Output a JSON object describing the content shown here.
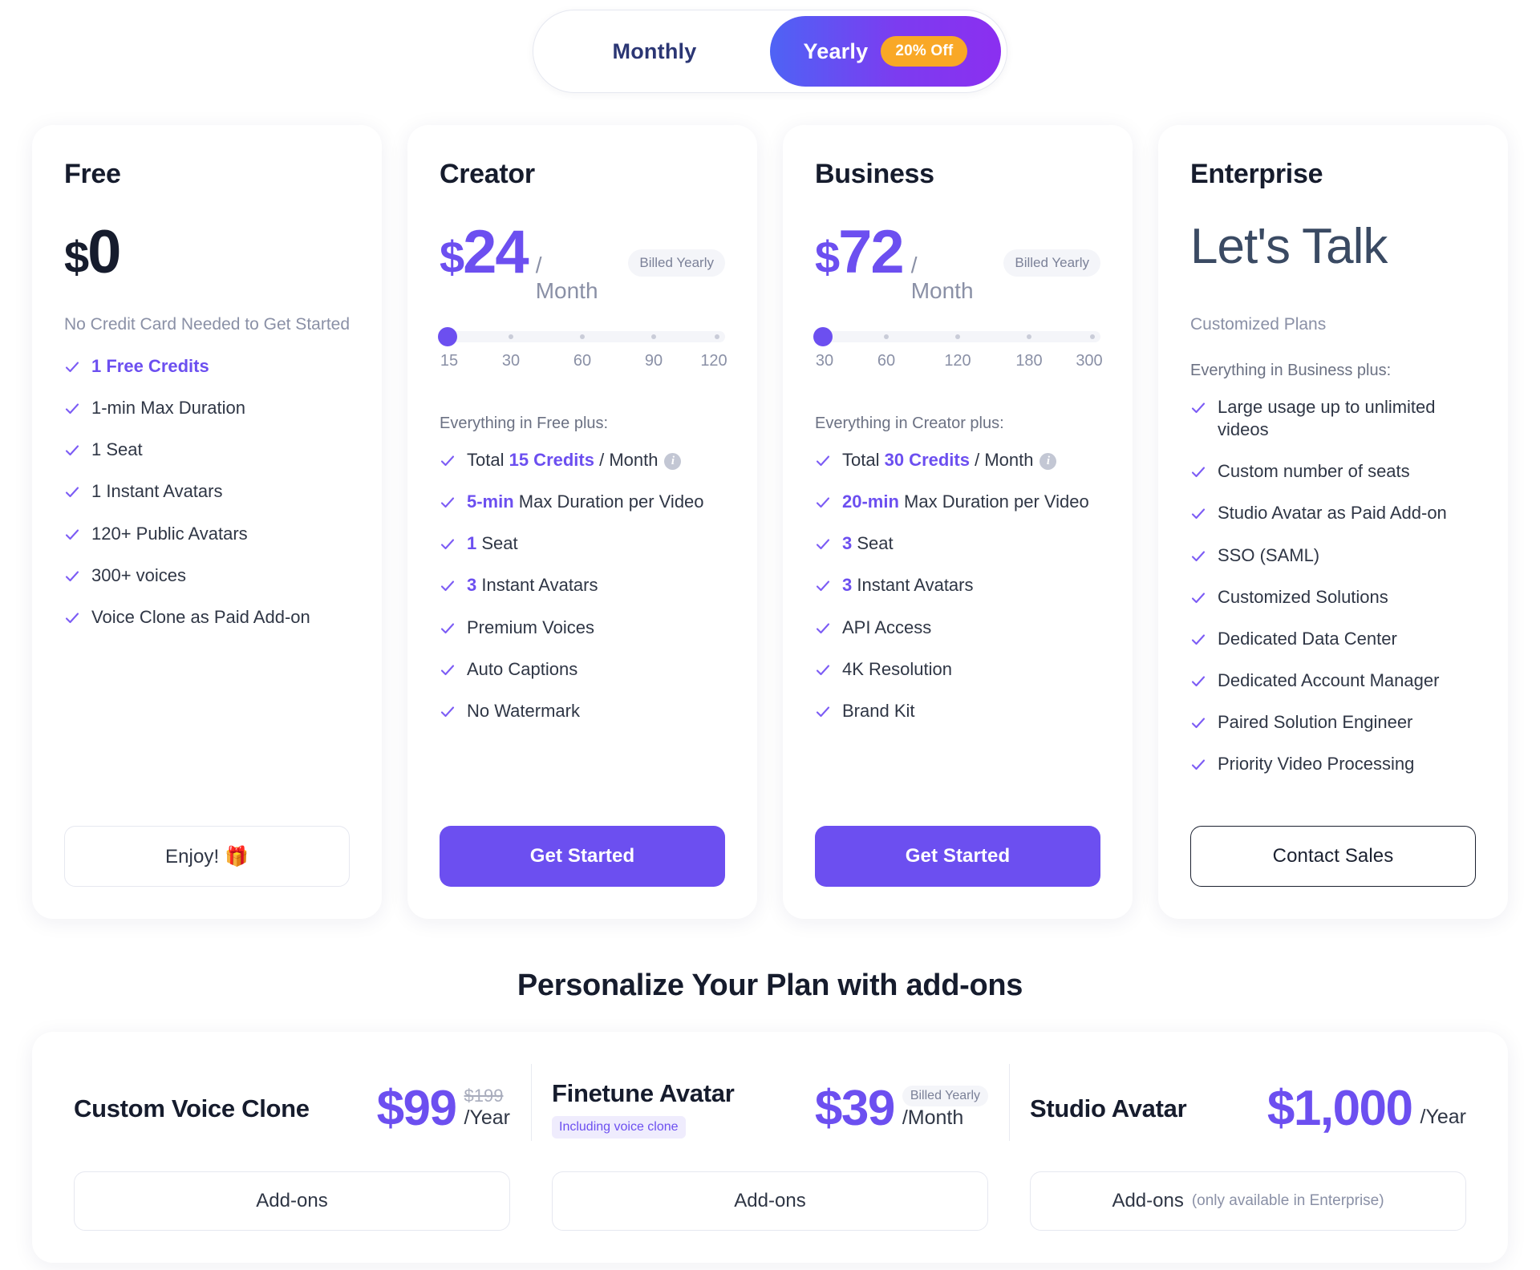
{
  "billing_toggle": {
    "monthly_label": "Monthly",
    "yearly_label": "Yearly",
    "discount_badge": "20% Off",
    "selected": "Yearly"
  },
  "accent_color": "#6c4ff0",
  "plans": [
    {
      "name": "Free",
      "currency": "$",
      "price": "0",
      "period": "",
      "billed": "",
      "subnote": "No Credit Card Needed to Get Started",
      "plus_line": "",
      "slider": null,
      "features": [
        {
          "text": "1 Free Credits",
          "style": "all-highlight"
        },
        {
          "text": "1-min Max Duration",
          "style": "plain"
        },
        {
          "text": "1 Seat",
          "style": "plain"
        },
        {
          "text": "1 Instant Avatars",
          "style": "plain"
        },
        {
          "text": "120+ Public Avatars",
          "style": "plain"
        },
        {
          "text": "300+ voices",
          "style": "plain"
        },
        {
          "text": "Voice Clone as Paid Add-on",
          "style": "plain"
        }
      ],
      "cta_label": "Enjoy! 🎁",
      "cta_style": "light"
    },
    {
      "name": "Creator",
      "currency": "$",
      "price": "24",
      "period": "/ Month",
      "billed": "Billed Yearly",
      "subnote": "",
      "plus_line": "Everything in Free plus:",
      "slider": {
        "ticks": [
          "15",
          "30",
          "60",
          "90",
          "120"
        ],
        "selected_index": 0
      },
      "features": [
        {
          "prefix": "Total ",
          "highlight": "15 Credits",
          "suffix": " / Month",
          "info": true,
          "style": "mixed"
        },
        {
          "highlight": "5-min",
          "suffix": " Max Duration per Video",
          "style": "mixed"
        },
        {
          "highlight": "1",
          "suffix": " Seat",
          "style": "mixed"
        },
        {
          "highlight": "3",
          "suffix": " Instant Avatars",
          "style": "mixed"
        },
        {
          "text": "Premium Voices",
          "style": "plain"
        },
        {
          "text": "Auto Captions",
          "style": "plain"
        },
        {
          "text": "No Watermark",
          "style": "plain"
        }
      ],
      "cta_label": "Get Started",
      "cta_style": "primary"
    },
    {
      "name": "Business",
      "currency": "$",
      "price": "72",
      "period": "/ Month",
      "billed": "Billed Yearly",
      "subnote": "",
      "plus_line": "Everything in Creator plus:",
      "slider": {
        "ticks": [
          "30",
          "60",
          "120",
          "180",
          "300"
        ],
        "selected_index": 0
      },
      "features": [
        {
          "prefix": "Total ",
          "highlight": "30 Credits",
          "suffix": " / Month",
          "info": true,
          "style": "mixed"
        },
        {
          "highlight": "20-min",
          "suffix": " Max Duration per Video",
          "style": "mixed"
        },
        {
          "highlight": "3",
          "suffix": " Seat",
          "style": "mixed"
        },
        {
          "highlight": "3",
          "suffix": " Instant Avatars",
          "style": "mixed"
        },
        {
          "text": "API Access",
          "style": "plain"
        },
        {
          "text": "4K Resolution",
          "style": "plain"
        },
        {
          "text": "Brand Kit",
          "style": "plain"
        }
      ],
      "cta_label": "Get Started",
      "cta_style": "primary"
    },
    {
      "name": "Enterprise",
      "currency": "",
      "price": "Let's Talk",
      "period": "",
      "billed": "",
      "subnote": "Customized Plans",
      "plus_line": "Everything in Business plus:",
      "slider": null,
      "features": [
        {
          "text": "Large usage up to unlimited videos",
          "style": "plain"
        },
        {
          "text": "Custom number of seats",
          "style": "plain"
        },
        {
          "text": "Studio Avatar as Paid Add-on",
          "style": "plain"
        },
        {
          "text": "SSO (SAML)",
          "style": "plain"
        },
        {
          "text": "Customized Solutions",
          "style": "plain"
        },
        {
          "text": "Dedicated Data Center",
          "style": "plain"
        },
        {
          "text": "Dedicated Account Manager",
          "style": "plain"
        },
        {
          "text": "Paired Solution Engineer",
          "style": "plain"
        },
        {
          "text": "Priority Video Processing",
          "style": "plain"
        }
      ],
      "cta_label": "Contact Sales",
      "cta_style": "outline-dark"
    }
  ],
  "addons_section": {
    "title": "Personalize Your Plan with add-ons",
    "items": [
      {
        "name": "Custom Voice Clone",
        "tag": "",
        "price": "$99",
        "strike": "$199",
        "period": "/Year",
        "billed": "",
        "button_label": "Add-ons",
        "button_note": ""
      },
      {
        "name": "Finetune Avatar",
        "tag": "Including voice clone",
        "price": "$39",
        "strike": "",
        "period": "/Month",
        "billed": "Billed Yearly",
        "button_label": "Add-ons",
        "button_note": ""
      },
      {
        "name": "Studio Avatar",
        "tag": "",
        "price": "$1,000",
        "strike": "",
        "period": "/Year",
        "billed": "",
        "button_label": "Add-ons",
        "button_note": "(only available in Enterprise)"
      }
    ]
  }
}
